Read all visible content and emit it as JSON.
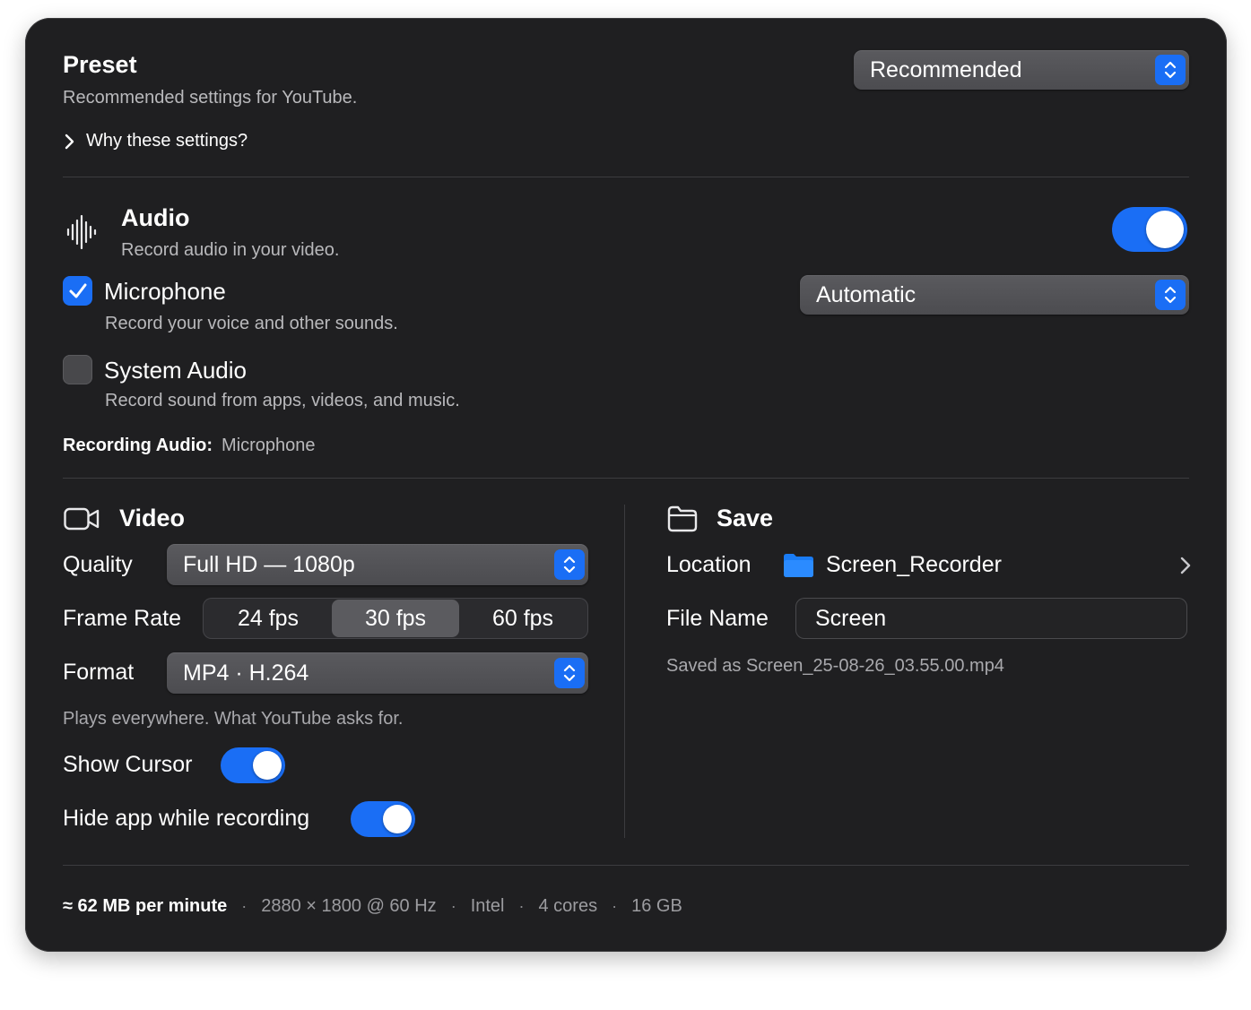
{
  "preset": {
    "title": "Preset",
    "subtitle": "Recommended settings for YouTube.",
    "disclosure": "Why these settings?",
    "select_value": "Recommended"
  },
  "audio": {
    "title": "Audio",
    "subtitle": "Record audio in your video.",
    "enabled": true,
    "microphone": {
      "label": "Microphone",
      "description": "Record your voice and other sounds.",
      "checked": true,
      "device": "Automatic"
    },
    "system_audio": {
      "label": "System Audio",
      "description": "Record sound from apps, videos, and music.",
      "checked": false
    },
    "recording_label": "Recording Audio:",
    "recording_value": "Microphone"
  },
  "video": {
    "title": "Video",
    "quality_label": "Quality",
    "quality_value": "Full HD — 1080p",
    "frame_rate_label": "Frame Rate",
    "frame_rates": [
      "24 fps",
      "30 fps",
      "60 fps"
    ],
    "frame_rate_selected": "30 fps",
    "format_label": "Format",
    "format_value": "MP4 · H.264",
    "format_note": "Plays everywhere. What YouTube asks for.",
    "show_cursor_label": "Show Cursor",
    "show_cursor": true,
    "hide_app_label": "Hide app while recording",
    "hide_app": true
  },
  "save": {
    "title": "Save",
    "location_label": "Location",
    "location_value": "Screen_Recorder",
    "file_name_label": "File Name",
    "file_name_value": "Screen",
    "saved_as": "Saved as Screen_25-08-26_03.55.00.mp4"
  },
  "footer": {
    "rate": "≈ 62 MB per minute",
    "resolution": "2880 × 1800 @ 60 Hz",
    "cpu": "Intel",
    "cores": "4 cores",
    "memory": "16 GB",
    "separator": "·"
  },
  "icons": {
    "preset_disclosure": "chevron-right-icon",
    "audio": "waveform-icon",
    "video": "video-camera-icon",
    "save": "folder-outline-icon",
    "location": "folder-icon",
    "location_chevron": "chevron-right-icon",
    "select_arrows": "up-down-chevron-icon",
    "checkmark": "checkmark-icon"
  },
  "colors": {
    "accent": "#1a6ef5",
    "panel": "#1f1f21",
    "folder": "#1a7cf5"
  }
}
